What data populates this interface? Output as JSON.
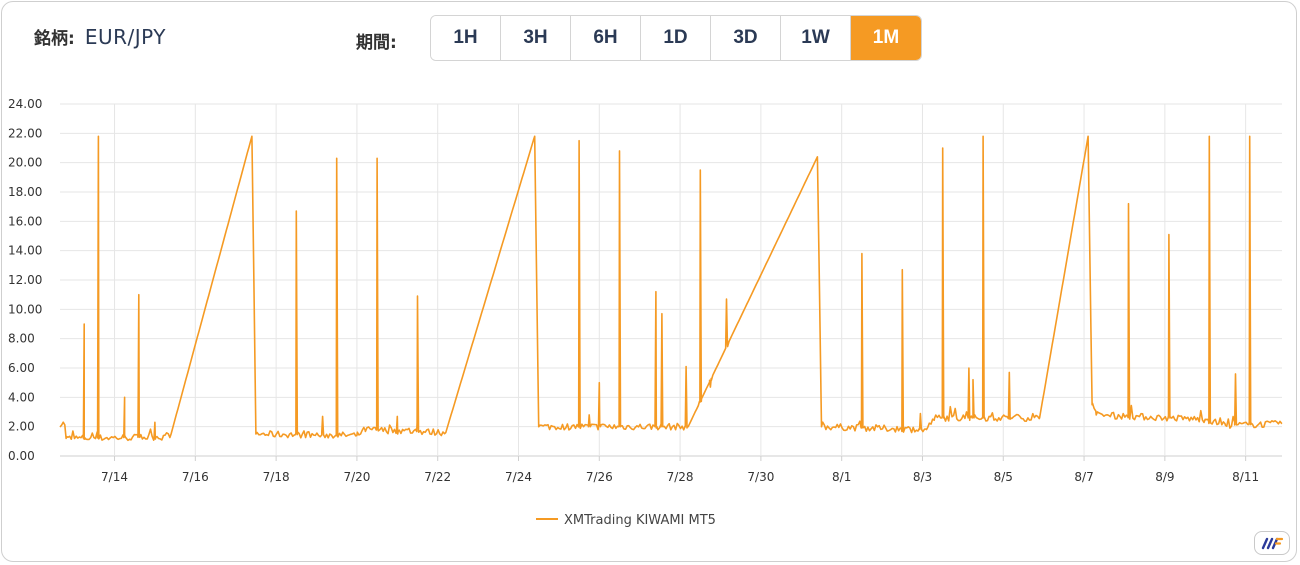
{
  "header": {
    "symbol_label": "銘柄:",
    "symbol_value": "EUR/JPY",
    "period_label": "期間:",
    "periods": [
      "1H",
      "3H",
      "6H",
      "1D",
      "3D",
      "1W",
      "1M"
    ],
    "active_period": "1M"
  },
  "colors": {
    "accent": "#f59a23",
    "line": "#f59a23",
    "text": "#2b3a55",
    "grid": "#e6e6e6"
  },
  "logo_icon": "brand-logo-icon",
  "chart_data": {
    "type": "line",
    "title": "",
    "xlabel": "",
    "ylabel": "",
    "ylim": [
      0,
      24
    ],
    "yticks": [
      "0.00",
      "2.00",
      "4.00",
      "6.00",
      "8.00",
      "10.00",
      "12.00",
      "14.00",
      "16.00",
      "18.00",
      "20.00",
      "22.00",
      "24.00"
    ],
    "xticks": [
      "7/14",
      "7/16",
      "7/18",
      "7/20",
      "7/22",
      "7/24",
      "7/26",
      "7/28",
      "7/30",
      "8/1",
      "8/3",
      "8/5",
      "8/7",
      "8/9",
      "8/11"
    ],
    "grid": true,
    "legend_position": "bottom-center",
    "series": [
      {
        "name": "XMTrading KIWAMI MT5",
        "baseline": [
          {
            "day": -0.2,
            "y": 1.2
          },
          {
            "day": 2.2,
            "y": 1.3
          },
          {
            "day": 2.4,
            "y": 1.5
          },
          {
            "day": 4.4,
            "y": 21.8
          },
          {
            "day": 4.5,
            "y": 1.5
          },
          {
            "day": 7.0,
            "y": 1.4
          },
          {
            "day": 7.2,
            "y": 1.8
          },
          {
            "day": 9.2,
            "y": 1.6
          },
          {
            "day": 11.4,
            "y": 21.8
          },
          {
            "day": 11.5,
            "y": 2.0
          },
          {
            "day": 15.2,
            "y": 2.0
          },
          {
            "day": 18.4,
            "y": 20.4
          },
          {
            "day": 18.5,
            "y": 2.0
          },
          {
            "day": 21.1,
            "y": 1.8
          },
          {
            "day": 21.3,
            "y": 2.6
          },
          {
            "day": 23.9,
            "y": 2.6
          },
          {
            "day": 25.1,
            "y": 21.8
          },
          {
            "day": 25.2,
            "y": 3.5
          },
          {
            "day": 25.3,
            "y": 2.8
          },
          {
            "day": 28.0,
            "y": 2.5
          },
          {
            "day": 28.5,
            "y": 2.1
          },
          {
            "day": 29.9,
            "y": 2.2
          }
        ],
        "spikes": [
          {
            "day": 0.25,
            "y": 9.0
          },
          {
            "day": 0.6,
            "y": 21.8
          },
          {
            "day": 1.25,
            "y": 4.0
          },
          {
            "day": 1.6,
            "y": 11.0
          },
          {
            "day": 2.0,
            "y": 2.3
          },
          {
            "day": 5.5,
            "y": 16.7
          },
          {
            "day": 6.15,
            "y": 2.7
          },
          {
            "day": 6.5,
            "y": 20.3
          },
          {
            "day": 7.5,
            "y": 20.3
          },
          {
            "day": 8.0,
            "y": 2.7
          },
          {
            "day": 8.5,
            "y": 10.9
          },
          {
            "day": 12.5,
            "y": 21.5
          },
          {
            "day": 12.75,
            "y": 2.8
          },
          {
            "day": 13.0,
            "y": 5.0
          },
          {
            "day": 13.5,
            "y": 20.8
          },
          {
            "day": 14.4,
            "y": 11.2
          },
          {
            "day": 14.55,
            "y": 9.7
          },
          {
            "day": 15.15,
            "y": 6.1
          },
          {
            "day": 15.5,
            "y": 19.5
          },
          {
            "day": 15.75,
            "y": 4.7
          },
          {
            "day": 16.15,
            "y": 10.7
          },
          {
            "day": 19.5,
            "y": 13.8
          },
          {
            "day": 20.5,
            "y": 12.7
          },
          {
            "day": 20.95,
            "y": 2.9
          },
          {
            "day": 21.5,
            "y": 21.0
          },
          {
            "day": 22.15,
            "y": 6.0
          },
          {
            "day": 22.25,
            "y": 5.2
          },
          {
            "day": 22.5,
            "y": 21.8
          },
          {
            "day": 23.15,
            "y": 5.7
          },
          {
            "day": 26.1,
            "y": 17.2
          },
          {
            "day": 27.1,
            "y": 15.1
          },
          {
            "day": 28.1,
            "y": 21.8
          },
          {
            "day": 28.75,
            "y": 5.6
          },
          {
            "day": 29.1,
            "y": 21.8
          }
        ]
      }
    ]
  }
}
